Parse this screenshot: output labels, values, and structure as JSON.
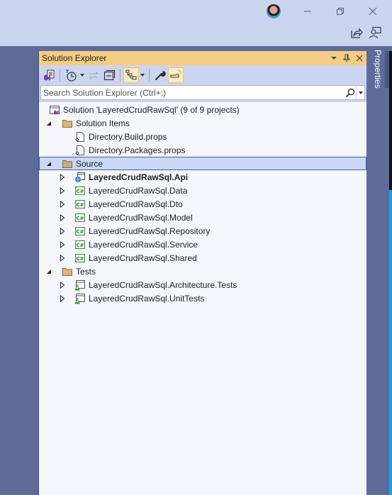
{
  "window": {
    "avatar_icon": "user-avatar",
    "minimize_icon": "minimize-icon",
    "restore_icon": "restore-icon",
    "close_icon": "close-icon",
    "share_icon": "live-share-icon",
    "feedback_icon": "feedback-icon"
  },
  "panel": {
    "title": "Solution Explorer",
    "header_buttons": [
      "window-position-dropdown",
      "pin",
      "close"
    ]
  },
  "toolbar": {
    "buttons": [
      {
        "name": "switch-views",
        "icon": "vs-solution-icon",
        "active": false
      },
      {
        "name": "pending-changes-filter",
        "icon": "clock-icon",
        "active": false,
        "dropdown": true
      },
      {
        "name": "sync-with-active-document",
        "icon": "sync-arrows-icon",
        "active": false,
        "disabled": true
      },
      {
        "name": "collapse-all",
        "icon": "collapse-all-icon",
        "active": false
      },
      {
        "name": "show-all-files",
        "icon": "hierarchy-icon",
        "active": true,
        "dropdown": true
      },
      {
        "name": "properties",
        "icon": "wrench-icon",
        "active": false
      },
      {
        "name": "preview-selected-items",
        "icon": "preview-icon",
        "active": true
      }
    ]
  },
  "search": {
    "placeholder": "Search Solution Explorer (Ctrl+;)",
    "value": ""
  },
  "tree": {
    "solution": "Solution 'LayeredCrudRawSql' (9 of 9 projects)",
    "solution_items": {
      "label": "Solution Items",
      "children": [
        "Directory.Build.props",
        "Directory.Packages.props"
      ]
    },
    "source": {
      "label": "Source",
      "selected": true,
      "children": [
        {
          "label": "LayeredCrudRawSql.Api",
          "type": "web",
          "bold": true
        },
        {
          "label": "LayeredCrudRawSql.Data",
          "type": "csharp"
        },
        {
          "label": "LayeredCrudRawSql.Dto",
          "type": "csharp"
        },
        {
          "label": "LayeredCrudRawSql.Model",
          "type": "csharp"
        },
        {
          "label": "LayeredCrudRawSql.Repository",
          "type": "csharp"
        },
        {
          "label": "LayeredCrudRawSql.Service",
          "type": "csharp"
        },
        {
          "label": "LayeredCrudRawSql.Shared",
          "type": "csharp"
        }
      ]
    },
    "tests": {
      "label": "Tests",
      "children": [
        {
          "label": "LayeredCrudRawSql.Architecture.Tests",
          "type": "test"
        },
        {
          "label": "LayeredCrudRawSql.UnitTests",
          "type": "test"
        }
      ]
    }
  },
  "side_tabs": {
    "properties": "Properties"
  },
  "colors": {
    "titlebar": "#ccd5f0",
    "panel_header": "#f5cc84",
    "selection": "#c9d8f5",
    "background": "#5d6b99",
    "accent_blue": "#10a5ee"
  }
}
